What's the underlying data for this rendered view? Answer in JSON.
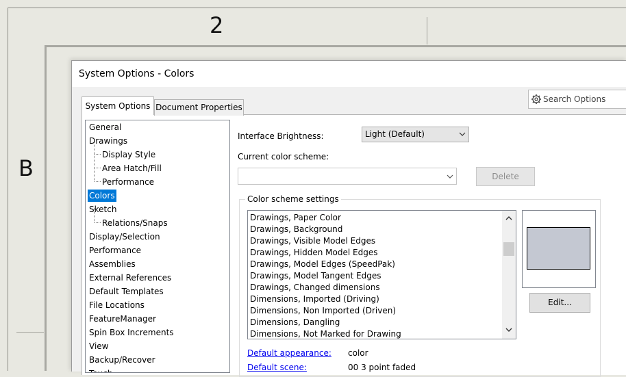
{
  "drawing": {
    "zone_top": "2",
    "zone_left": "B"
  },
  "dialog": {
    "title": "System Options - Colors",
    "search": {
      "placeholder": "Search Options",
      "icon": "gear-icon"
    },
    "tabs": [
      {
        "label": "System Options",
        "active": true
      },
      {
        "label": "Document Properties",
        "active": false
      }
    ],
    "tree": [
      {
        "label": "General",
        "level": 0
      },
      {
        "label": "Drawings",
        "level": 0
      },
      {
        "label": "Display Style",
        "level": 1
      },
      {
        "label": "Area Hatch/Fill",
        "level": 1
      },
      {
        "label": "Performance",
        "level": 1
      },
      {
        "label": "Colors",
        "level": 0,
        "selected": true
      },
      {
        "label": "Sketch",
        "level": 0
      },
      {
        "label": "Relations/Snaps",
        "level": 1
      },
      {
        "label": "Display/Selection",
        "level": 0
      },
      {
        "label": "Performance",
        "level": 0
      },
      {
        "label": "Assemblies",
        "level": 0
      },
      {
        "label": "External References",
        "level": 0
      },
      {
        "label": "Default Templates",
        "level": 0
      },
      {
        "label": "File Locations",
        "level": 0
      },
      {
        "label": "FeatureManager",
        "level": 0
      },
      {
        "label": "Spin Box Increments",
        "level": 0
      },
      {
        "label": "View",
        "level": 0
      },
      {
        "label": "Backup/Recover",
        "level": 0
      },
      {
        "label": "Touch",
        "level": 0
      }
    ],
    "brightness": {
      "label": "Interface Brightness:",
      "value": "Light (Default)"
    },
    "scheme": {
      "label": "Current color scheme:",
      "value": "",
      "delete_label": "Delete"
    },
    "color_settings": {
      "title": "Color scheme settings",
      "items": [
        "Drawings, Paper Color",
        "Drawings, Background",
        "Drawings, Visible Model Edges",
        "Drawings, Hidden Model Edges",
        "Drawings, Model Edges (SpeedPak)",
        "Drawings, Model Tangent Edges",
        "Drawings, Changed dimensions",
        "Dimensions, Imported (Driving)",
        "Dimensions, Non Imported (Driven)",
        "Dimensions, Dangling",
        "Dimensions, Not Marked for Drawing"
      ],
      "preview_color": "#c4c8d2",
      "edit_label": "Edit..."
    },
    "default_appearance": {
      "label": "Default appearance:",
      "value": "color"
    },
    "default_scene": {
      "label": "Default scene:",
      "value": "00 3 point faded"
    }
  },
  "colors": {
    "selection": "#0078d7",
    "link": "#0000ee"
  }
}
